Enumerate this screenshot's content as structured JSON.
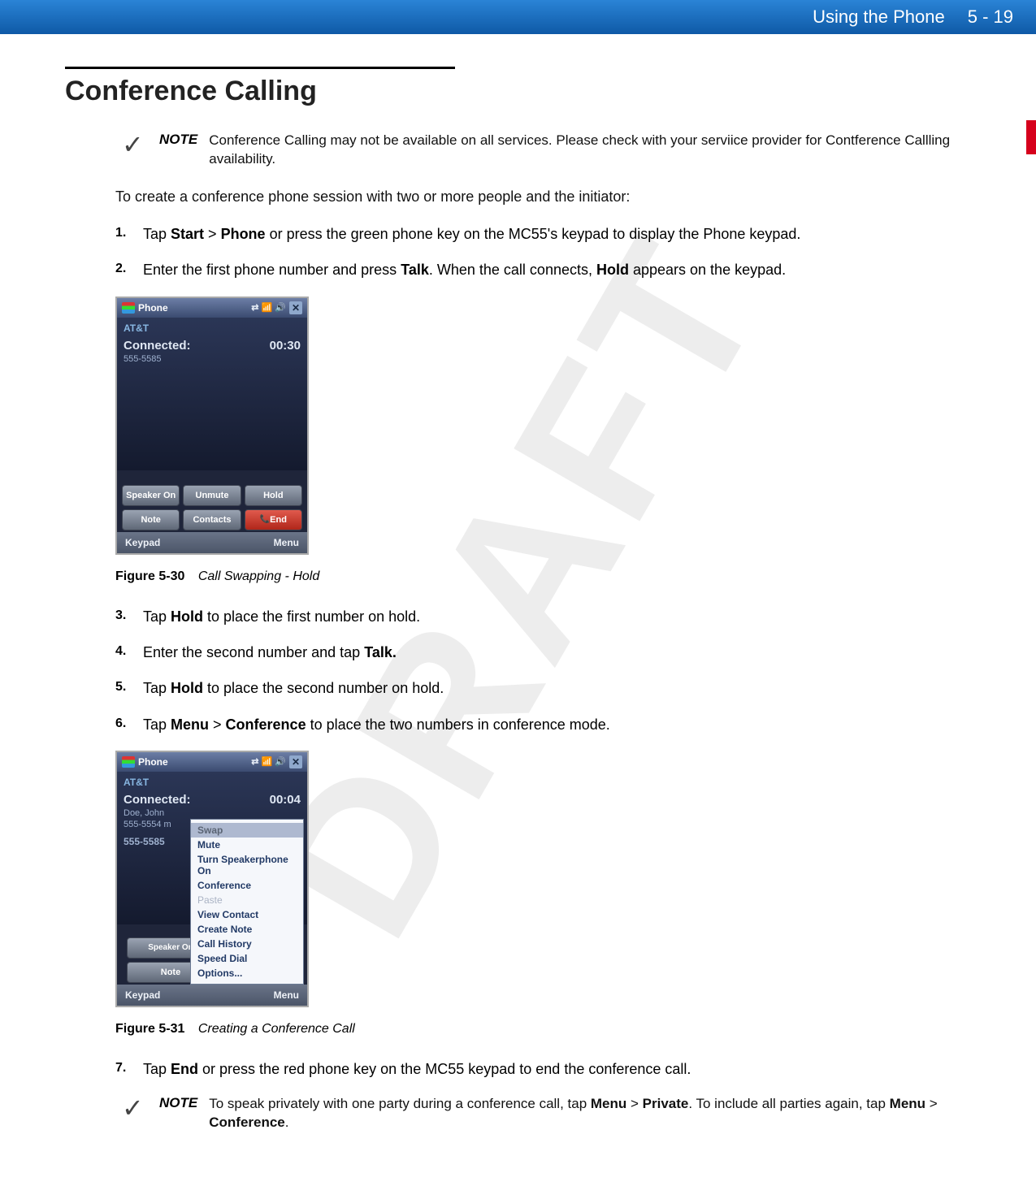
{
  "header": {
    "chapter": "Using the Phone",
    "page": "5 - 19"
  },
  "watermark": "DRAFT",
  "section": {
    "title": "Conference Calling"
  },
  "notes": {
    "n1_label": "NOTE",
    "n1_text": "Conference Calling may not be available on all services. Please check with your serviice provider for Contference Callling availability.",
    "n2_label": "NOTE",
    "n2_text_a": "To speak privately with one party during a conference call, tap ",
    "n2_menu": "Menu",
    "n2_gt1": " > ",
    "n2_private": "Private",
    "n2_text_b": ". To include all parties again, tap ",
    "n2_menu2": "Menu",
    "n2_gt2": " > ",
    "n2_conference": "Conference",
    "n2_period": "."
  },
  "intro": "To create a conference phone session with two or more people and the initiator:",
  "steps": {
    "s1_num": "1.",
    "s1_a": "Tap ",
    "s1_start": "Start",
    "s1_gt": " > ",
    "s1_phone": "Phone",
    "s1_b": " or press the green phone key on the MC55's keypad to display the Phone keypad.",
    "s2_num": "2.",
    "s2_a": "Enter the first phone number and press ",
    "s2_talk": "Talk",
    "s2_b": ". When the call connects, ",
    "s2_hold": "Hold",
    "s2_c": " appears on the keypad.",
    "s3_num": "3.",
    "s3_a": "Tap ",
    "s3_hold": "Hold",
    "s3_b": " to place the first number on hold.",
    "s4_num": "4.",
    "s4_a": "Enter the second number and tap ",
    "s4_talk": "Talk.",
    "s5_num": "5.",
    "s5_a": "Tap ",
    "s5_hold": "Hold",
    "s5_b": " to place the second number on hold.",
    "s6_num": "6.",
    "s6_a": "Tap ",
    "s6_menu": "Menu",
    "s6_gt": " > ",
    "s6_conf": "Conference",
    "s6_b": " to place the two numbers in conference mode.",
    "s7_num": "7.",
    "s7_a": "Tap ",
    "s7_end": "End",
    "s7_b": " or press the red phone key on the MC55 keypad to end the conference call."
  },
  "figures": {
    "f1_label": "Figure 5-30",
    "f1_title": "Call Swapping - Hold",
    "f2_label": "Figure 5-31",
    "f2_title": "Creating a Conference Call"
  },
  "shot1": {
    "title": "Phone",
    "sys": "⇄ 📶 🔊",
    "carrier": "AT&T",
    "status": "Connected:",
    "timer": "00:30",
    "number": "555-5585",
    "btn_speaker": "Speaker On",
    "btn_unmute": "Unmute",
    "btn_hold": "Hold",
    "btn_note": "Note",
    "btn_contacts": "Contacts",
    "btn_end": "End",
    "soft_left": "Keypad",
    "soft_right": "Menu"
  },
  "shot2": {
    "title": "Phone",
    "sys": "⇄ 📶 🔊",
    "carrier": "AT&T",
    "status": "Connected:",
    "timer": "00:04",
    "line1": "Doe, John",
    "line2": "555-5554 m",
    "line3": "555-5585",
    "btn_speaker": "Speaker On",
    "btn_note": "Note",
    "soft_left": "Keypad",
    "soft_right": "Menu",
    "menu": {
      "swap": "Swap",
      "mute": "Mute",
      "spk": "Turn Speakerphone On",
      "conf": "Conference",
      "paste": "Paste",
      "view": "View Contact",
      "create": "Create Note",
      "hist": "Call History",
      "speed": "Speed Dial",
      "opt": "Options..."
    }
  }
}
